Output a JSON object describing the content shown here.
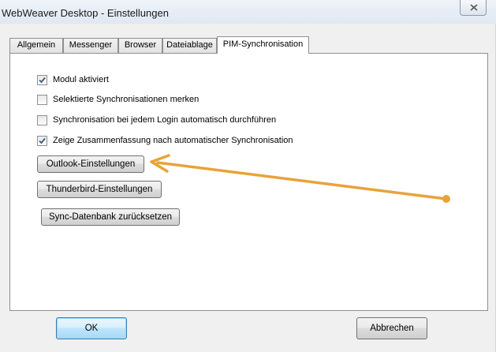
{
  "window": {
    "title": "WebWeaver Desktop - Einstellungen"
  },
  "tabs": [
    {
      "label": "Allgemein",
      "active": false
    },
    {
      "label": "Messenger",
      "active": false
    },
    {
      "label": "Browser",
      "active": false
    },
    {
      "label": "Dateiablage",
      "active": false
    },
    {
      "label": "PIM-Synchronisation",
      "active": true
    }
  ],
  "options": [
    {
      "label": "Modul aktiviert",
      "checked": true
    },
    {
      "label": "Selektierte Synchronisationen merken",
      "checked": false
    },
    {
      "label": "Synchronisation bei jedem Login automatisch durchführen",
      "checked": false
    },
    {
      "label": "Zeige Zusammenfassung nach automatischer Synchronisation",
      "checked": true
    }
  ],
  "buttons": {
    "outlook": "Outlook-Einstellungen",
    "thunderbird": "Thunderbird-Einstellungen",
    "reset_db": "Sync-Datenbank zurücksetzen",
    "ok": "OK",
    "cancel": "Abbrechen"
  },
  "annotation": {
    "color": "#e8a33a",
    "points_to": "Outlook-Einstellungen"
  }
}
